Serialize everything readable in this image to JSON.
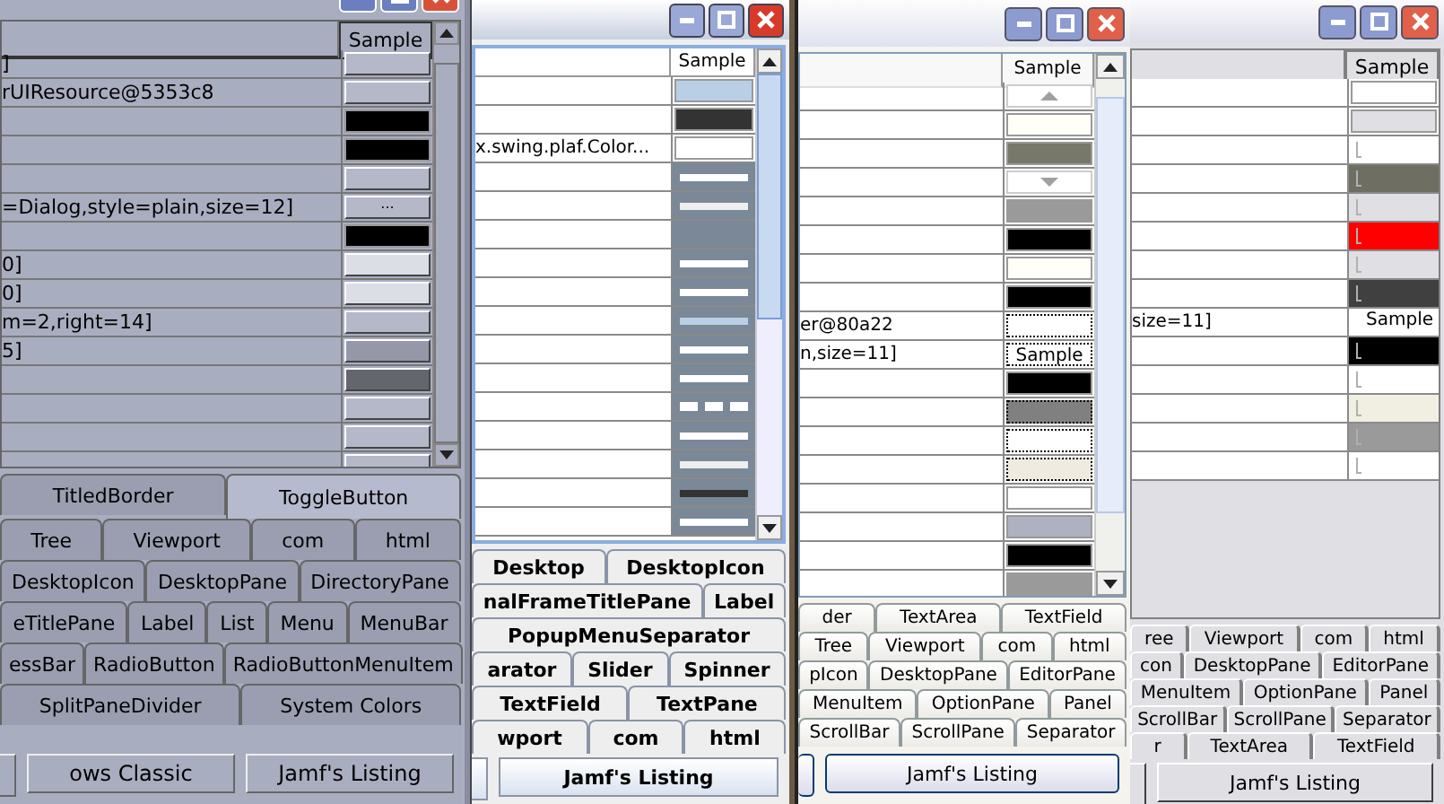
{
  "windows": [
    {
      "kind": "metal",
      "table": {
        "header": "Sample",
        "rows": [
          {
            "value": "]",
            "sample": {
              "kind": "button",
              "color": "#b4b8c8"
            }
          },
          {
            "value": "rUIResource@5353c8",
            "sample": {
              "kind": "button",
              "color": "#b4b8c8"
            }
          },
          {
            "sample": {
              "kind": "color",
              "color": "#000000"
            }
          },
          {
            "sample": {
              "kind": "color",
              "color": "#000000"
            }
          },
          {
            "sample": {
              "kind": "button",
              "color": "#b4b8c8"
            }
          },
          {
            "value": "=Dialog,style=plain,size=12]",
            "sample": {
              "kind": "button",
              "color": "#b4b8c8",
              "text": "..."
            }
          },
          {
            "sample": {
              "kind": "color",
              "color": "#000000"
            }
          },
          {
            "value": "0]",
            "sample": {
              "kind": "button",
              "color": "#dcdee6"
            }
          },
          {
            "value": "0]",
            "sample": {
              "kind": "button",
              "color": "#dcdee6"
            }
          },
          {
            "value": "m=2,right=14]",
            "sample": {
              "kind": "button",
              "color": "#b4b8c8"
            }
          },
          {
            "value": "5]",
            "sample": {
              "kind": "button",
              "color": "#9498a8"
            }
          },
          {
            "sample": {
              "kind": "button",
              "color": "#64666e"
            }
          },
          {
            "sample": {
              "kind": "button",
              "color": "#b4b8c8"
            }
          },
          {
            "sample": {
              "kind": "button",
              "color": "#b4b8c8"
            }
          },
          {
            "sample": {
              "kind": "button",
              "color": "#b4b8c8"
            }
          }
        ]
      },
      "tabs": [
        [
          {
            "label": "TitledBorder",
            "selected": false
          },
          {
            "label": "ToggleButton",
            "selected": true
          }
        ],
        [
          {
            "label": "Tree",
            "selected": false
          },
          {
            "label": "Viewport",
            "selected": false
          },
          {
            "label": "com",
            "selected": false
          },
          {
            "label": "html",
            "selected": false
          }
        ],
        [
          {
            "label": "DesktopIcon",
            "selected": false
          },
          {
            "label": "DesktopPane",
            "selected": false
          },
          {
            "label": "DirectoryPane",
            "selected": false
          }
        ],
        [
          {
            "label": "eTitlePane",
            "selected": false
          },
          {
            "label": "Label",
            "selected": false
          },
          {
            "label": "List",
            "selected": false
          },
          {
            "label": "Menu",
            "selected": false
          },
          {
            "label": "MenuBar",
            "selected": false
          }
        ],
        [
          {
            "label": "essBar",
            "selected": false
          },
          {
            "label": "RadioButton",
            "selected": false
          },
          {
            "label": "RadioButtonMenuItem",
            "selected": false
          }
        ],
        [
          {
            "label": "SplitPaneDivider",
            "selected": false
          },
          {
            "label": "System Colors",
            "selected": false
          }
        ]
      ],
      "buttons": [
        "ows Classic",
        "Jamf's Listing"
      ]
    },
    {
      "kind": "ocean",
      "table": {
        "header": "Sample",
        "rows": [
          {
            "sample": {
              "kind": "color",
              "color": "#b8cfe5"
            }
          },
          {
            "sample": {
              "kind": "color",
              "color": "#333333"
            }
          },
          {
            "value": "x.swing.plaf.Color...",
            "sample": {
              "kind": "color",
              "color": "#ffffff"
            }
          },
          {
            "sample": {
              "kind": "line",
              "color": "#ffffff"
            }
          },
          {
            "sample": {
              "kind": "line",
              "color": "#eeeeee"
            }
          },
          {
            "sample": {
              "kind": "line"
            }
          },
          {
            "sample": {
              "kind": "line",
              "color": "#ffffff"
            }
          },
          {
            "sample": {
              "kind": "line",
              "color": "#ffffff"
            }
          },
          {
            "sample": {
              "kind": "line",
              "color": "#b8cfe5"
            }
          },
          {
            "sample": {
              "kind": "line",
              "color": "#ffffff"
            }
          },
          {
            "sample": {
              "kind": "line",
              "color": "#ffffff"
            }
          },
          {
            "sample": {
              "kind": "dashed",
              "color": "#ffffff"
            }
          },
          {
            "sample": {
              "kind": "line",
              "color": "#ffffff"
            }
          },
          {
            "sample": {
              "kind": "line",
              "color": "#eeeeee"
            }
          },
          {
            "sample": {
              "kind": "line",
              "color": "#333333"
            }
          },
          {
            "sample": {
              "kind": "line",
              "color": "#ffffff"
            }
          }
        ]
      },
      "tabs": [
        [
          {
            "label": "Desktop",
            "selected": false
          },
          {
            "label": "DesktopIcon",
            "selected": false
          }
        ],
        [
          {
            "label": "nalFrameTitlePane",
            "selected": false
          },
          {
            "label": "Label",
            "selected": false
          }
        ],
        [
          {
            "label": "PopupMenuSeparator",
            "selected": false
          }
        ],
        [
          {
            "label": "arator",
            "selected": false
          },
          {
            "label": "Slider",
            "selected": false
          },
          {
            "label": "Spinner",
            "selected": false
          }
        ],
        [
          {
            "label": "TextField",
            "selected": false
          },
          {
            "label": "TextPane",
            "selected": false
          }
        ],
        [
          {
            "label": "wport",
            "selected": false
          },
          {
            "label": "com",
            "selected": false
          },
          {
            "label": "html",
            "selected": false
          }
        ]
      ],
      "buttons": [
        "Jamf's Listing"
      ]
    },
    {
      "kind": "luna",
      "table": {
        "header": "Sample",
        "rows": [
          {
            "sample": {
              "kind": "uparrow"
            }
          },
          {
            "sample": {
              "kind": "color",
              "color": "#fffff8"
            }
          },
          {
            "sample": {
              "kind": "color",
              "color": "#77776a"
            }
          },
          {
            "sample": {
              "kind": "downarrow"
            }
          },
          {
            "sample": {
              "kind": "color",
              "color": "#9a9a9a"
            }
          },
          {
            "sample": {
              "kind": "color",
              "color": "#000000"
            }
          },
          {
            "sample": {
              "kind": "color",
              "color": "#fffff8"
            }
          },
          {
            "sample": {
              "kind": "color",
              "color": "#000000"
            }
          },
          {
            "value": "er@80a22",
            "sample": {
              "kind": "dotted",
              "color": "#ffffff"
            }
          },
          {
            "value": "n,size=11]",
            "sample": {
              "kind": "text",
              "text": "Sample"
            }
          },
          {
            "sample": {
              "kind": "color",
              "color": "#000000"
            }
          },
          {
            "sample": {
              "kind": "dotted",
              "color": "#808080"
            }
          },
          {
            "sample": {
              "kind": "dotted",
              "color": "#ffffff"
            }
          },
          {
            "sample": {
              "kind": "dotted",
              "color": "#efebe0"
            }
          },
          {
            "sample": {
              "kind": "color",
              "color": "#ffffff"
            }
          },
          {
            "sample": {
              "kind": "color",
              "color": "#aeb2c0"
            }
          },
          {
            "sample": {
              "kind": "color",
              "color": "#000000"
            }
          },
          {
            "sample": {
              "kind": "color",
              "color": "#9a9a9a"
            }
          }
        ]
      },
      "tabs": [
        [
          {
            "label": "der",
            "selected": false
          },
          {
            "label": "TextArea",
            "selected": false
          },
          {
            "label": "TextField",
            "selected": false
          }
        ],
        [
          {
            "label": "Tree",
            "selected": false
          },
          {
            "label": "Viewport",
            "selected": false
          },
          {
            "label": "com",
            "selected": false
          },
          {
            "label": "html",
            "selected": false
          }
        ],
        [
          {
            "label": "pIcon",
            "selected": false
          },
          {
            "label": "DesktopPane",
            "selected": false
          },
          {
            "label": "EditorPane",
            "selected": false
          }
        ],
        [
          {
            "label": "MenuItem",
            "selected": false
          },
          {
            "label": "OptionPane",
            "selected": false
          },
          {
            "label": "Panel",
            "selected": false
          }
        ],
        [
          {
            "label": "ScrollBar",
            "selected": false
          },
          {
            "label": "ScrollPane",
            "selected": false
          },
          {
            "label": "Separator",
            "selected": false
          }
        ]
      ],
      "buttons": [
        "Jamf's Listing"
      ]
    },
    {
      "kind": "classic",
      "table": {
        "header": "Sample",
        "rows": [
          {
            "sample": {
              "kind": "color",
              "color": "#ffffff"
            }
          },
          {
            "sample": {
              "kind": "color",
              "color": "#e0dfe3"
            }
          },
          {
            "sample": {
              "kind": "marked",
              "color": "#ffffff"
            }
          },
          {
            "sample": {
              "kind": "marked",
              "color": "#6f6e63"
            }
          },
          {
            "sample": {
              "kind": "marked",
              "color": "#e0dfe3"
            }
          },
          {
            "sample": {
              "kind": "marked",
              "color": "#ff0000"
            }
          },
          {
            "sample": {
              "kind": "marked",
              "color": "#e0dfe3"
            }
          },
          {
            "sample": {
              "kind": "marked",
              "color": "#404040"
            }
          },
          {
            "value": "size=11]",
            "sample": {
              "kind": "text",
              "text": "Sample"
            }
          },
          {
            "sample": {
              "kind": "marked",
              "color": "#000000"
            }
          },
          {
            "sample": {
              "kind": "marked",
              "color": "#ffffff"
            }
          },
          {
            "sample": {
              "kind": "marked",
              "color": "#f1efe2"
            }
          },
          {
            "sample": {
              "kind": "marked",
              "color": "#9a9a9a"
            }
          },
          {
            "sample": {
              "kind": "marked",
              "color": "#ffffff"
            }
          }
        ]
      },
      "tabs": [
        [
          {
            "label": "ree",
            "selected": false
          },
          {
            "label": "Viewport",
            "selected": false
          },
          {
            "label": "com",
            "selected": false
          },
          {
            "label": "html",
            "selected": false
          }
        ],
        [
          {
            "label": "con",
            "selected": false
          },
          {
            "label": "DesktopPane",
            "selected": false
          },
          {
            "label": "EditorPane",
            "selected": false
          }
        ],
        [
          {
            "label": "MenuItem",
            "selected": false
          },
          {
            "label": "OptionPane",
            "selected": false
          },
          {
            "label": "Panel",
            "selected": false
          }
        ],
        [
          {
            "label": "ScrollBar",
            "selected": false
          },
          {
            "label": "ScrollPane",
            "selected": false
          },
          {
            "label": "Separator",
            "selected": false
          }
        ],
        [
          {
            "label": "r",
            "selected": false
          },
          {
            "label": "TextArea",
            "selected": false
          },
          {
            "label": "TextField",
            "selected": false
          }
        ]
      ],
      "buttons": [
        "Jamf's Listing"
      ]
    }
  ]
}
